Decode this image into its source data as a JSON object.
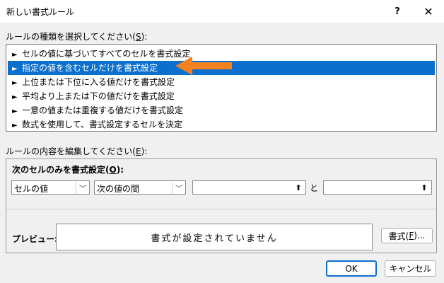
{
  "window": {
    "title": "新しい書式ルール",
    "help": "?",
    "close": "✕"
  },
  "rule_type": {
    "label": "ルールの種類を選択してください(",
    "accel": "S",
    "suffix": "):",
    "items": [
      {
        "label": "セルの値に基づいてすべてのセルを書式設定",
        "selected": false
      },
      {
        "label": "指定の値を含むセルだけを書式設定",
        "selected": true
      },
      {
        "label": "上位または下位に入る値だけを書式設定",
        "selected": false
      },
      {
        "label": "平均より上または下の値だけを書式設定",
        "selected": false
      },
      {
        "label": "一意の値または重複する値だけを書式設定",
        "selected": false
      },
      {
        "label": "数式を使用して、書式設定するセルを決定",
        "selected": false
      }
    ]
  },
  "rule_edit": {
    "label": "ルールの内容を編集してください(",
    "accel": "E",
    "suffix": "):",
    "panel_title": "次のセルのみを書式設定(",
    "panel_accel": "O",
    "panel_suffix": "):",
    "condition_type": "セルの値",
    "operator": "次の値の間",
    "value1": "",
    "and_label": "と",
    "value2": ""
  },
  "preview": {
    "label": "プレビュー:",
    "text": "書式が設定されていません",
    "format_button": "書式(",
    "format_accel": "F",
    "format_suffix": ")..."
  },
  "buttons": {
    "ok": "OK",
    "cancel": "キャンセル"
  },
  "colors": {
    "selection": "#0b6fce",
    "arrow": "#f58220"
  }
}
